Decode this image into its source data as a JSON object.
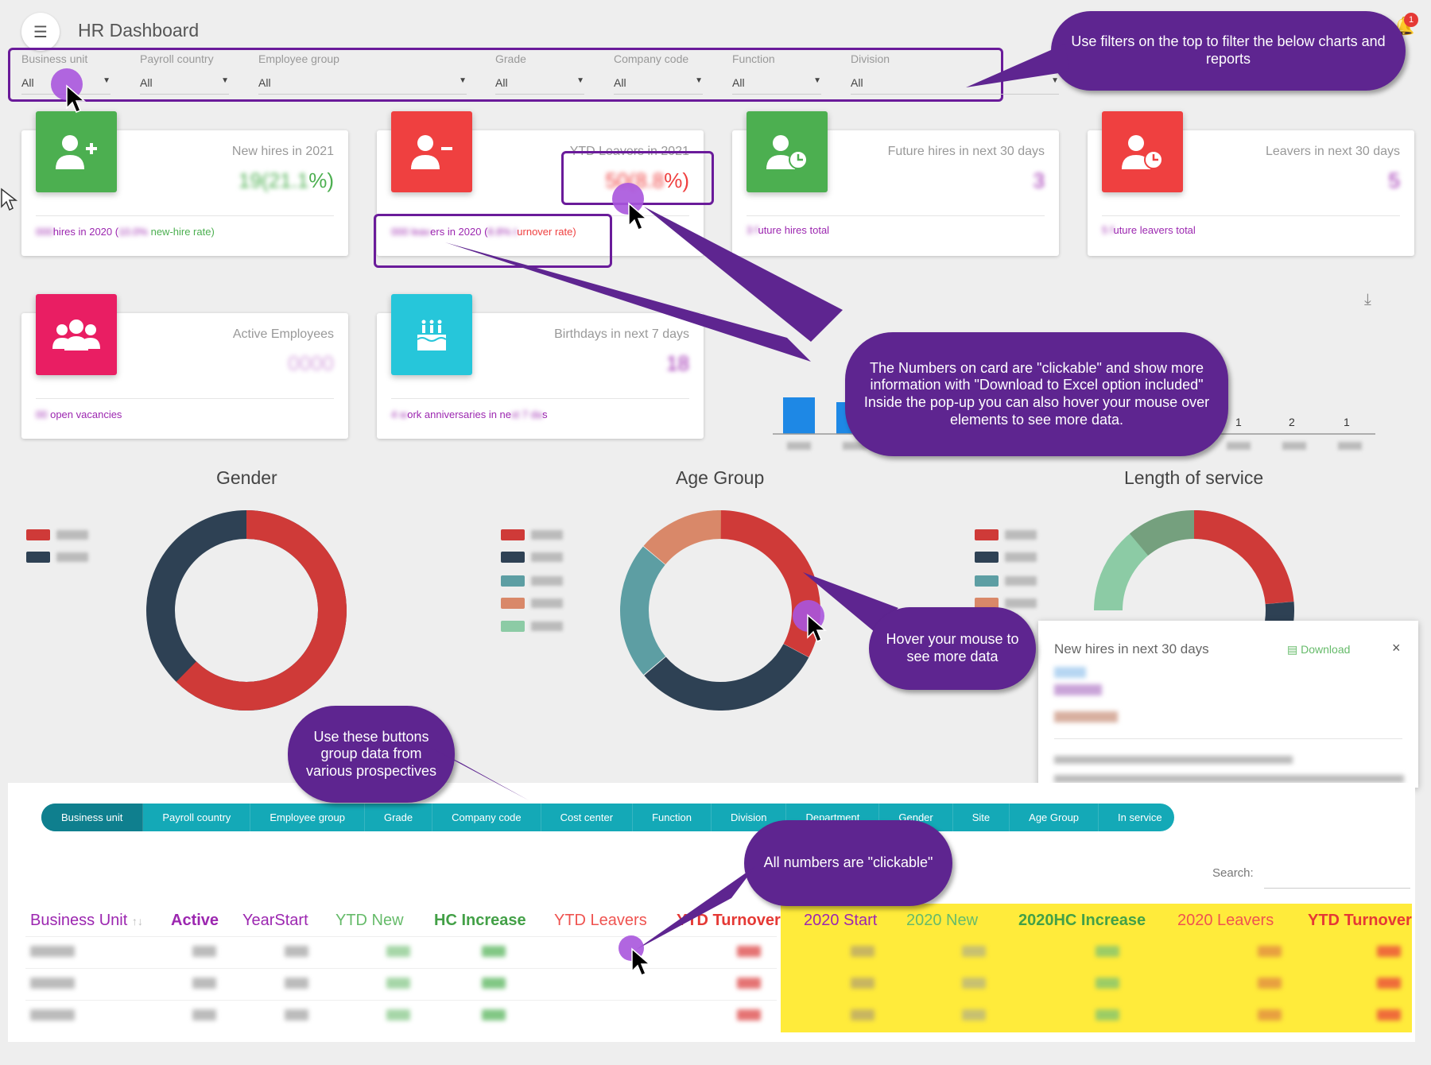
{
  "header": {
    "title": "HR Dashboard",
    "notification_count": "1"
  },
  "filters": [
    {
      "label": "Business unit",
      "value": "All"
    },
    {
      "label": "Payroll country",
      "value": "All"
    },
    {
      "label": "Employee group",
      "value": "All"
    },
    {
      "label": "Grade",
      "value": "All"
    },
    {
      "label": "Company code",
      "value": "All"
    },
    {
      "label": "Function",
      "value": "All"
    },
    {
      "label": "Division",
      "value": "All"
    }
  ],
  "cards": [
    {
      "title": "New hires in 2021",
      "value_suffix": "%)",
      "footer_mid": "hires in 2020 (",
      "footer_end": "new-hire rate)",
      "color": "#4caf50",
      "icon": "add-user-icon"
    },
    {
      "title": "YTD Leavers in 2021",
      "value_suffix": "%)",
      "footer_mid": "ers in 2020 (",
      "footer_end": "urnover rate)",
      "color": "#ef4040",
      "icon": "remove-user-icon"
    },
    {
      "title": "Future hires in next 30 days",
      "footer_end": "uture hires total",
      "color": "#4caf50",
      "icon": "user-clock-icon"
    },
    {
      "title": "Leavers in next 30 days",
      "footer_end": "uture leavers total",
      "color": "#ef4040",
      "icon": "user-clock-icon"
    },
    {
      "title": "Active Employees",
      "footer_end": "open vacancies",
      "color": "#e91e63",
      "icon": "users-icon"
    },
    {
      "title": "Birthdays in next 7 days",
      "footer_mid": "ork anniversaries in ne",
      "footer_end": "s",
      "color": "#26c6da",
      "icon": "birthday-cake-icon"
    }
  ],
  "callouts": {
    "filters": "Use filters on the top to filter the below charts and reports",
    "cards": "The Numbers on card are \"clickable\" and show more information with \"Download to Excel option included\" Inside the pop-up you can also hover your mouse over elements to see more data.",
    "hover": "Hover your mouse to see more data",
    "buttons": "Use these buttons group data from various prospectives",
    "numbers": "All numbers are \"clickable\""
  },
  "bar_chart_labels": [
    "1",
    "2",
    "1"
  ],
  "charts": {
    "gender": {
      "title": "Gender"
    },
    "age": {
      "title": "Age Group"
    },
    "service": {
      "title": "Length of service"
    }
  },
  "colors": {
    "red": "#cf3a38",
    "navy": "#2e4154",
    "teal": "#5d9ea3",
    "salmon": "#d98869",
    "mint": "#8ccba5",
    "olive": "#75a07e",
    "purple": "#5e2590",
    "tab": "#14a9b7"
  },
  "popup": {
    "title": "New hires in next 30 days",
    "download": "Download",
    "close": "×"
  },
  "tabs": [
    "Business unit",
    "Payroll country",
    "Employee group",
    "Grade",
    "Company code",
    "Cost center",
    "Function",
    "Division",
    "Department",
    "Gender",
    "Site",
    "Age Group",
    "In service"
  ],
  "search": {
    "label": "Search:"
  },
  "table": {
    "headers": [
      {
        "text": "Business Unit",
        "color": "#9c27b0"
      },
      {
        "text": "Active",
        "color": "#9c27b0"
      },
      {
        "text": "YearStart",
        "color": "#9c27b0"
      },
      {
        "text": "YTD New",
        "color": "#66bb6a"
      },
      {
        "text": "HC Increase",
        "color": "#43a047"
      },
      {
        "text": "YTD Leavers",
        "color": "#ef5350"
      },
      {
        "text": "YTD Turnover",
        "color": "#e53935"
      },
      {
        "text": "2020 Start",
        "color": "#9c27b0"
      },
      {
        "text": "2020 New",
        "color": "#66bb6a"
      },
      {
        "text": "2020HC Increase",
        "color": "#43a047"
      },
      {
        "text": "2020 Leavers",
        "color": "#ef5350"
      },
      {
        "text": "YTD Turnover",
        "color": "#e53935"
      }
    ],
    "sort_icon": "↑↓"
  }
}
